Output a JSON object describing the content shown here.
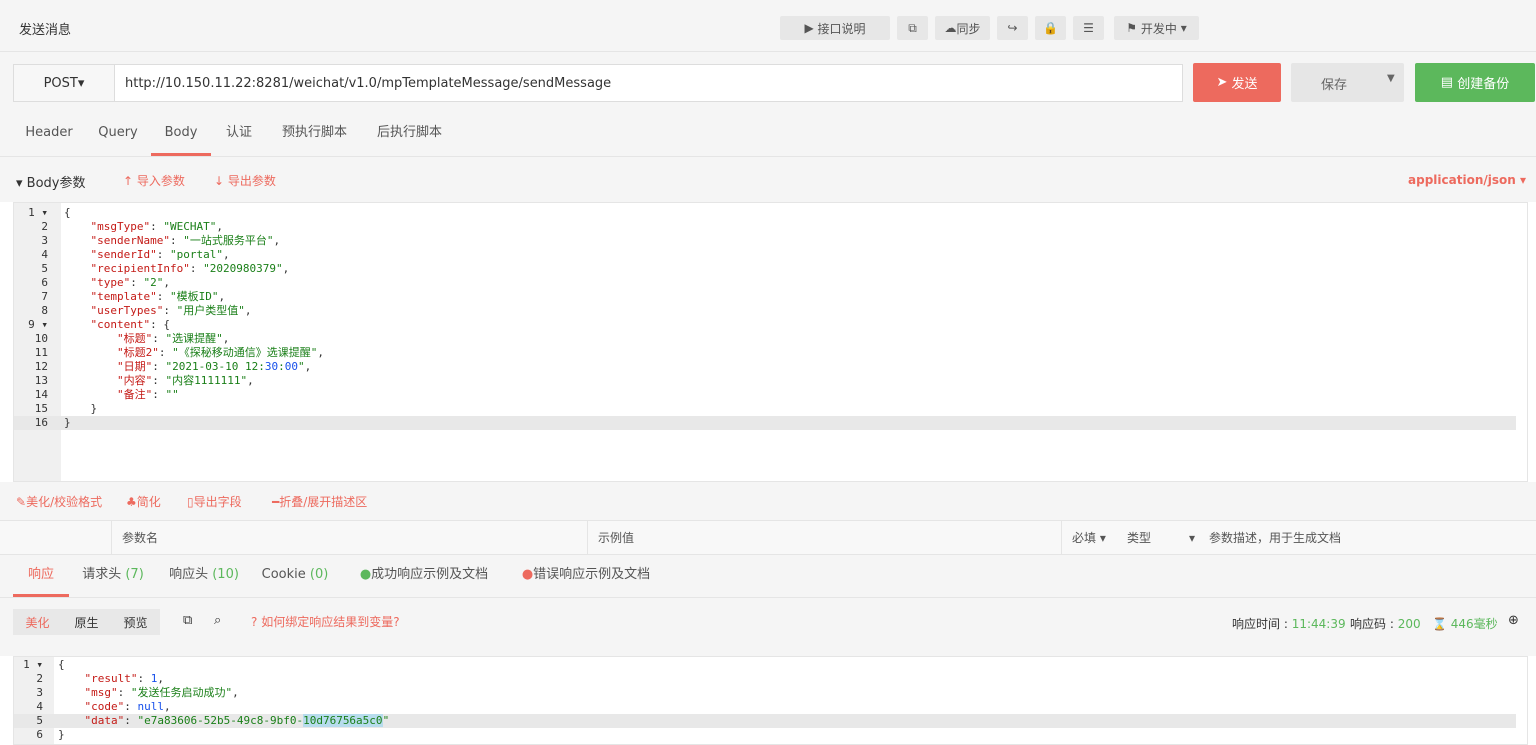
{
  "header": {
    "title": "发送消息",
    "api_docs": "接口说明",
    "sync": "同步",
    "status": "开发中"
  },
  "request": {
    "method": "POST",
    "url": "http://10.150.11.22:8281/weichat/v1.0/mpTemplateMessage/sendMessage",
    "send": "发送",
    "save": "保存",
    "backup": "创建备份"
  },
  "tabs": [
    "Header",
    "Query",
    "Body",
    "认证",
    "预执行脚本",
    "后执行脚本"
  ],
  "body": {
    "title": "Body参数",
    "import": "导入参数",
    "export": "导出参数",
    "content_type": "application/json"
  },
  "code": [
    {
      "n": "1",
      "t": "{"
    },
    {
      "n": "2",
      "t": "    \"msgType\": \"WECHAT\","
    },
    {
      "n": "3",
      "t": "    \"senderName\": \"一站式服务平台\","
    },
    {
      "n": "4",
      "t": "    \"senderId\": \"portal\","
    },
    {
      "n": "5",
      "t": "    \"recipientInfo\": \"2020980379\","
    },
    {
      "n": "6",
      "t": "    \"type\": \"2\","
    },
    {
      "n": "7",
      "t": "    \"template\": \"模板ID\","
    },
    {
      "n": "8",
      "t": "    \"userTypes\": \"用户类型值\","
    },
    {
      "n": "9",
      "t": "    \"content\": {"
    },
    {
      "n": "10",
      "t": "        \"标题\": \"选课提醒\","
    },
    {
      "n": "11",
      "t": "        \"标题2\": \"《探秘移动通信》选课提醒\","
    },
    {
      "n": "12",
      "t": "        \"日期\": \"2021-03-10 12:30:00\","
    },
    {
      "n": "13",
      "t": "        \"内容\": \"内容1111111\","
    },
    {
      "n": "14",
      "t": "        \"备注\": \"\""
    },
    {
      "n": "15",
      "t": "    }"
    },
    {
      "n": "16",
      "t": "}"
    }
  ],
  "actions": {
    "beautify": "美化/校验格式",
    "simplify": "简化",
    "export_fields": "导出字段",
    "toggle": "折叠/展开描述区"
  },
  "params": {
    "name": "参数名",
    "example": "示例值",
    "required": "必填",
    "type": "类型",
    "description": "参数描述，用于生成文档"
  },
  "response_tabs": {
    "response": "响应",
    "request_headers": "请求头",
    "request_headers_count": "(7)",
    "response_headers": "响应头",
    "response_headers_count": "(10)",
    "cookie": "Cookie",
    "cookie_count": "(0)",
    "success": "成功响应示例及文档",
    "error": "错误响应示例及文档"
  },
  "response_toolbar": {
    "pretty": "美化",
    "raw": "原生",
    "preview": "预览",
    "help": "如何绑定响应结果到变量?",
    "time_label": "响应时间 :",
    "time": "11:44:39",
    "code_label": "响应码 :",
    "code": "200",
    "duration": "446毫秒"
  },
  "response": [
    {
      "n": "1",
      "t": "{"
    },
    {
      "n": "2",
      "t": "    \"result\": 1,"
    },
    {
      "n": "3",
      "t": "    \"msg\": \"发送任务启动成功\","
    },
    {
      "n": "4",
      "t": "    \"code\": null,"
    },
    {
      "n": "5a",
      "t": "    \"data\": \"e7a83606-52b5-49c8-9bf0-"
    },
    {
      "n": "5b",
      "t": "10d76756a5c0"
    },
    {
      "n": "5c",
      "t": "\""
    },
    {
      "n": "6",
      "t": "}"
    }
  ]
}
